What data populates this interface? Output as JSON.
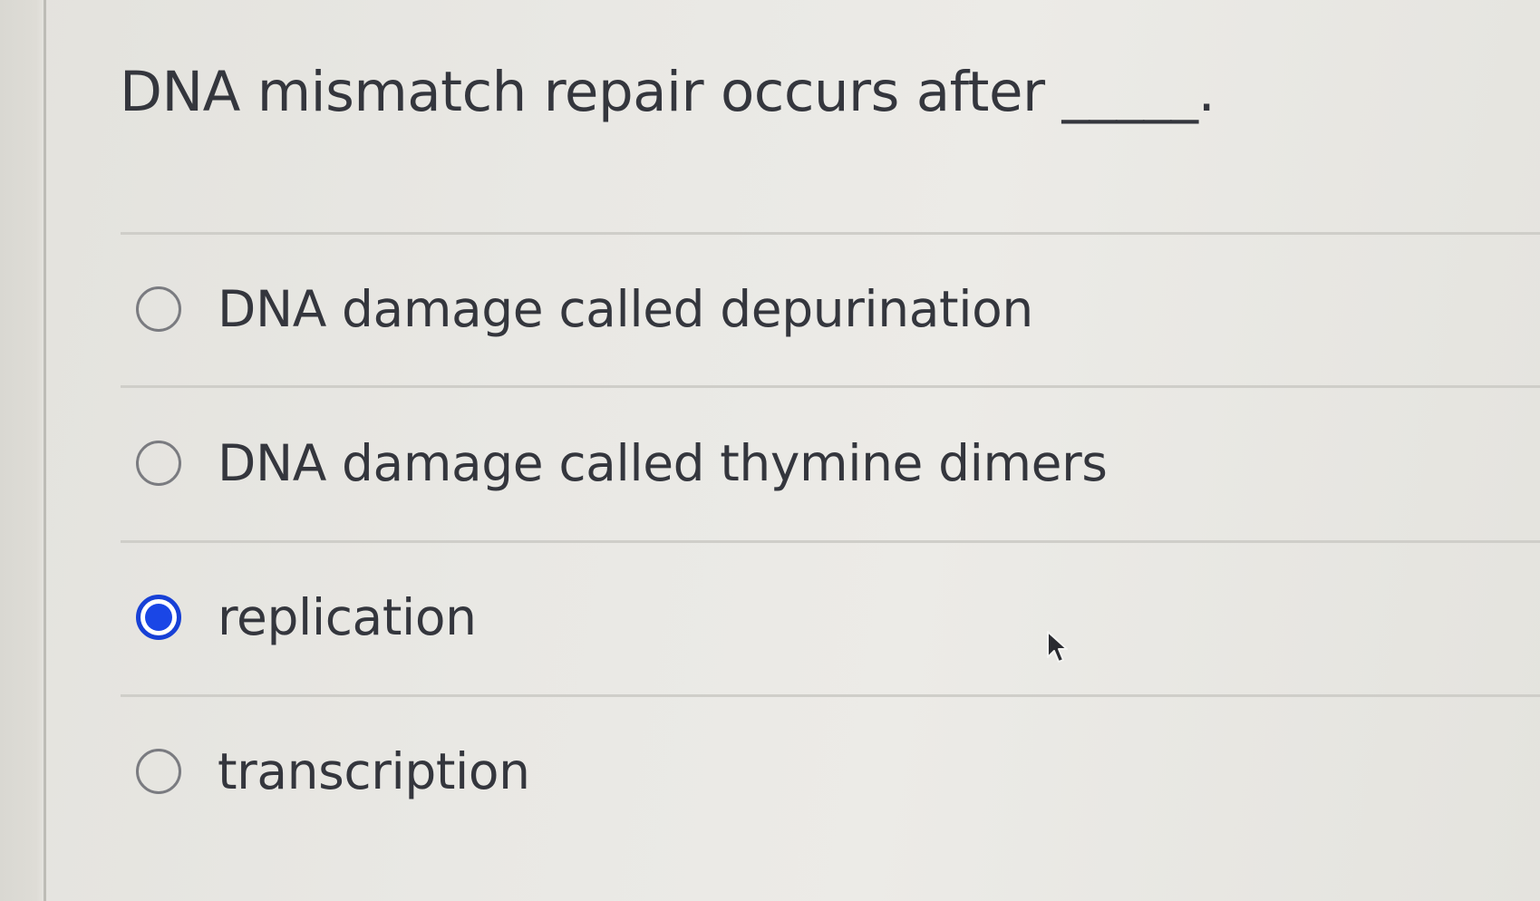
{
  "question": {
    "text": "DNA mismatch repair occurs after _____."
  },
  "options": [
    {
      "label": "DNA damage called depurination",
      "selected": false
    },
    {
      "label": "DNA damage called thymine dimers",
      "selected": false
    },
    {
      "label": "replication",
      "selected": true
    },
    {
      "label": "transcription",
      "selected": false
    }
  ],
  "colors": {
    "radio_selected": "#1a46e6",
    "radio_unselected_border": "#7a7b80",
    "text": "#34363d"
  },
  "icons": {
    "cursor": "mouse-pointer-arrow-icon"
  }
}
